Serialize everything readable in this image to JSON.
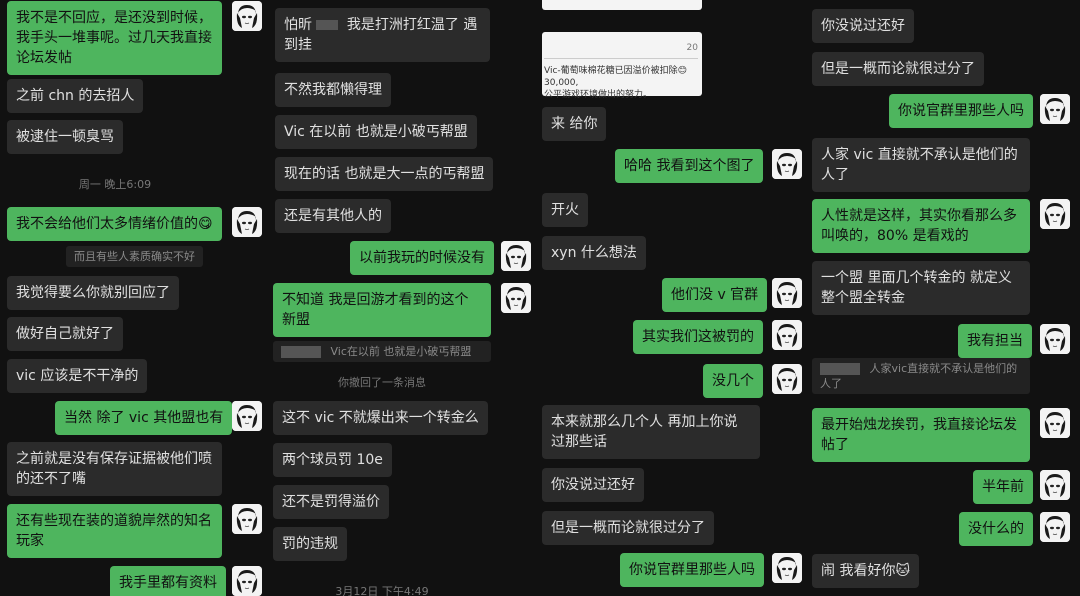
{
  "col1": {
    "m1": "我不是不回应，是还没到时候，我手头一堆事呢。过几天我直接论坛发帖",
    "m2": "之前 chn 的去招人",
    "m3": "被逮住一顿臭骂",
    "ts1": "周一 晚上6:09",
    "m4": "我不会给他们太多情绪价值的😋",
    "q1": "而且有些人素质确实不好",
    "m5": "我觉得要么你就别回应了",
    "m6": "做好自己就好了",
    "m7": "vic 应该是不干净的",
    "m8": "当然 除了 vic 其他盟也有",
    "m9": "之前就是没有保存证据被他们喷的还不了嘴",
    "m10": "还有些现在装的道貌岸然的知名玩家",
    "m11": "我手里都有资料"
  },
  "col2": {
    "m1a": "怕昕",
    "m1b": "我是打洲打红温了 遇到挂",
    "m2": "不然我都懒得理",
    "m3": "Vic 在以前 也就是小破丐帮盟",
    "m4": "现在的话 也就是大一点的丐帮盟",
    "m5": "还是有其他人的",
    "m6": "以前我玩的时候没有",
    "m7": "不知道 我是回游才看到的这个新盟",
    "q1": "Vic在以前 也就是小破丐帮盟",
    "recall": "你撤回了一条消息",
    "m8": "这不 vic 不就爆出来一个转金么",
    "m9": "两个球员罚 10e",
    "m10": "还不是罚得溢价",
    "m11": "罚的违规",
    "ts1": "3月12日 下午4:49"
  },
  "col3": {
    "card_num": "20",
    "card_line1": "Vic-葡萄味棉花糖已因溢价被扣除😊30,000,",
    "card_line2": "公平游戏环境做出的努力。",
    "m1": "来 给你",
    "m2": "哈哈 我看到这个图了",
    "m3": "开火",
    "m4": "xyn 什么想法",
    "m5": "他们没 v 官群",
    "m6": "其实我们这被罚的",
    "m7": "没几个",
    "m8": "本来就那么几个人 再加上你说过那些话",
    "m9": "你没说过还好",
    "m10": "但是一概而论就很过分了",
    "m11": "你说官群里那些人吗"
  },
  "col4": {
    "m1": "你没说过还好",
    "m2": "但是一概而论就很过分了",
    "m3": "你说官群里那些人吗",
    "m4": "人家 vic 直接就不承认是他们的人了",
    "m5": "人性就是这样，其实你看那么多叫唤的，80% 是看戏的",
    "m6": "一个盟 里面几个转金的 就定义整个盟全转金",
    "m7": "我有担当",
    "q1": "人家vic直接就不承认是他们的人了",
    "m8": "最开始烛龙挨罚，我直接论坛发帖了",
    "m9": "半年前",
    "m10": "没什么的",
    "m11": "闹 我看好你🐱"
  }
}
